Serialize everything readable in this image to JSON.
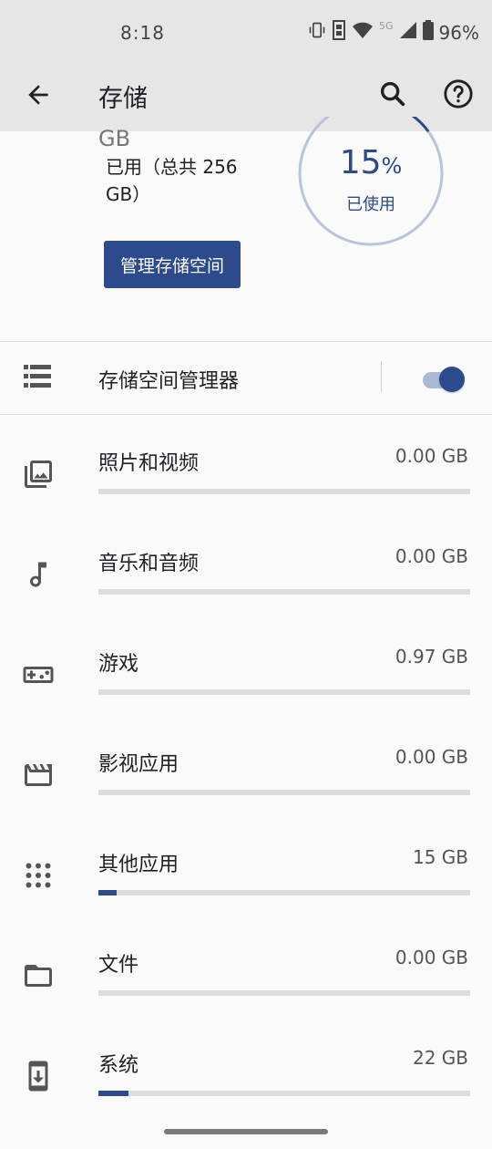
{
  "status": {
    "time": "8:18",
    "network": "5G",
    "battery": "96%"
  },
  "appbar": {
    "title": "存储",
    "icons": [
      "back-arrow-icon",
      "search-icon",
      "help-icon"
    ]
  },
  "summary": {
    "cut_text": "GB",
    "used_text": "已用（总共 256 GB）",
    "percent": "15",
    "percent_symbol": "%",
    "percent_caption": "已使用",
    "percent_value": 0.15,
    "manage_button": "管理存储空间"
  },
  "storage_manager": {
    "label": "存储空间管理器",
    "enabled": true
  },
  "categories": [
    {
      "label": "照片和视频",
      "size": "0.00 GB",
      "icon": "photo-library-icon",
      "fraction": 0.0
    },
    {
      "label": "音乐和音频",
      "size": "0.00 GB",
      "icon": "music-note-icon",
      "fraction": 0.0
    },
    {
      "label": "游戏",
      "size": "0.97 GB",
      "icon": "gamepad-icon",
      "fraction": 0.0
    },
    {
      "label": "影视应用",
      "size": "0.00 GB",
      "icon": "movie-icon",
      "fraction": 0.0
    },
    {
      "label": "其他应用",
      "size": "15 GB",
      "icon": "apps-grid-icon",
      "fraction": 0.05
    },
    {
      "label": "文件",
      "size": "0.00 GB",
      "icon": "folder-icon",
      "fraction": 0.0
    },
    {
      "label": "系统",
      "size": "22 GB",
      "icon": "system-update-icon",
      "fraction": 0.08
    }
  ],
  "colors": {
    "accent": "#2c4a8c",
    "track": "#dcdcdc",
    "ring": "#b8c4dc"
  }
}
